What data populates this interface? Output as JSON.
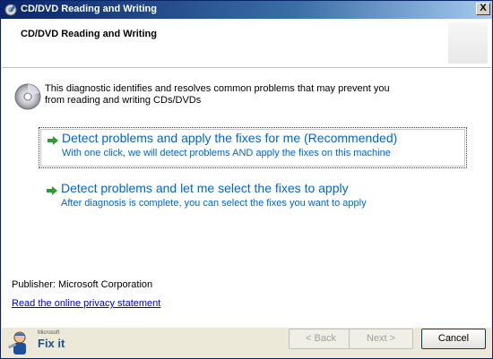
{
  "window": {
    "title": "CD/DVD Reading and Writing",
    "close_label": "X"
  },
  "header": {
    "title": "CD/DVD Reading and Writing"
  },
  "intro": "This diagnostic identifies and resolves common problems that may prevent you from reading and writing CDs/DVDs",
  "options": [
    {
      "title": "Detect problems and apply the fixes for me (Recommended)",
      "subtitle": "With one click, we will detect problems AND apply the fixes on this machine"
    },
    {
      "title": "Detect problems and let me select the fixes to apply",
      "subtitle": "After diagnosis is complete, you can select the fixes you want to apply"
    }
  ],
  "publisher": "Publisher: Microsoft Corporation",
  "privacy_link": "Read the online privacy statement",
  "logo": {
    "brand": "Microsoft",
    "product": "Fix it"
  },
  "buttons": {
    "back": "< Back",
    "next": "Next >",
    "cancel": "Cancel"
  },
  "colors": {
    "link": "#0066cc",
    "arrow": "#2e9c2e",
    "title_bar": "#0a246a"
  }
}
